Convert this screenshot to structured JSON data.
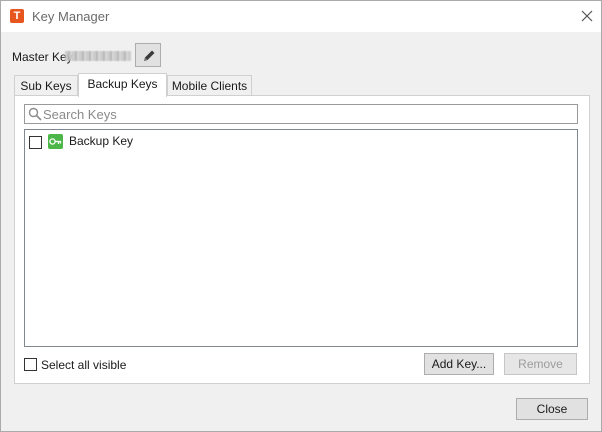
{
  "window": {
    "title": "Key Manager",
    "app_icon_letter": "T",
    "app_icon_color": "#e8561f"
  },
  "master_key": {
    "label": "Master Key"
  },
  "icons": {
    "app": "app-logo-icon",
    "close": "close-icon",
    "edit": "pencil-icon",
    "search": "search-icon",
    "key": "key-icon"
  },
  "tabs": [
    {
      "label": "Sub Keys",
      "active": false
    },
    {
      "label": "Backup Keys",
      "active": true
    },
    {
      "label": "Mobile Clients",
      "active": false
    }
  ],
  "search": {
    "placeholder": "Search Keys",
    "value": ""
  },
  "list": {
    "items": [
      {
        "label": "Backup Key",
        "checked": false,
        "icon_color": "#4cb648"
      }
    ]
  },
  "footer": {
    "select_all_label": "Select all visible",
    "add_key_label": "Add Key...",
    "remove_label": "Remove",
    "remove_enabled": false
  },
  "bottom": {
    "close_label": "Close"
  }
}
